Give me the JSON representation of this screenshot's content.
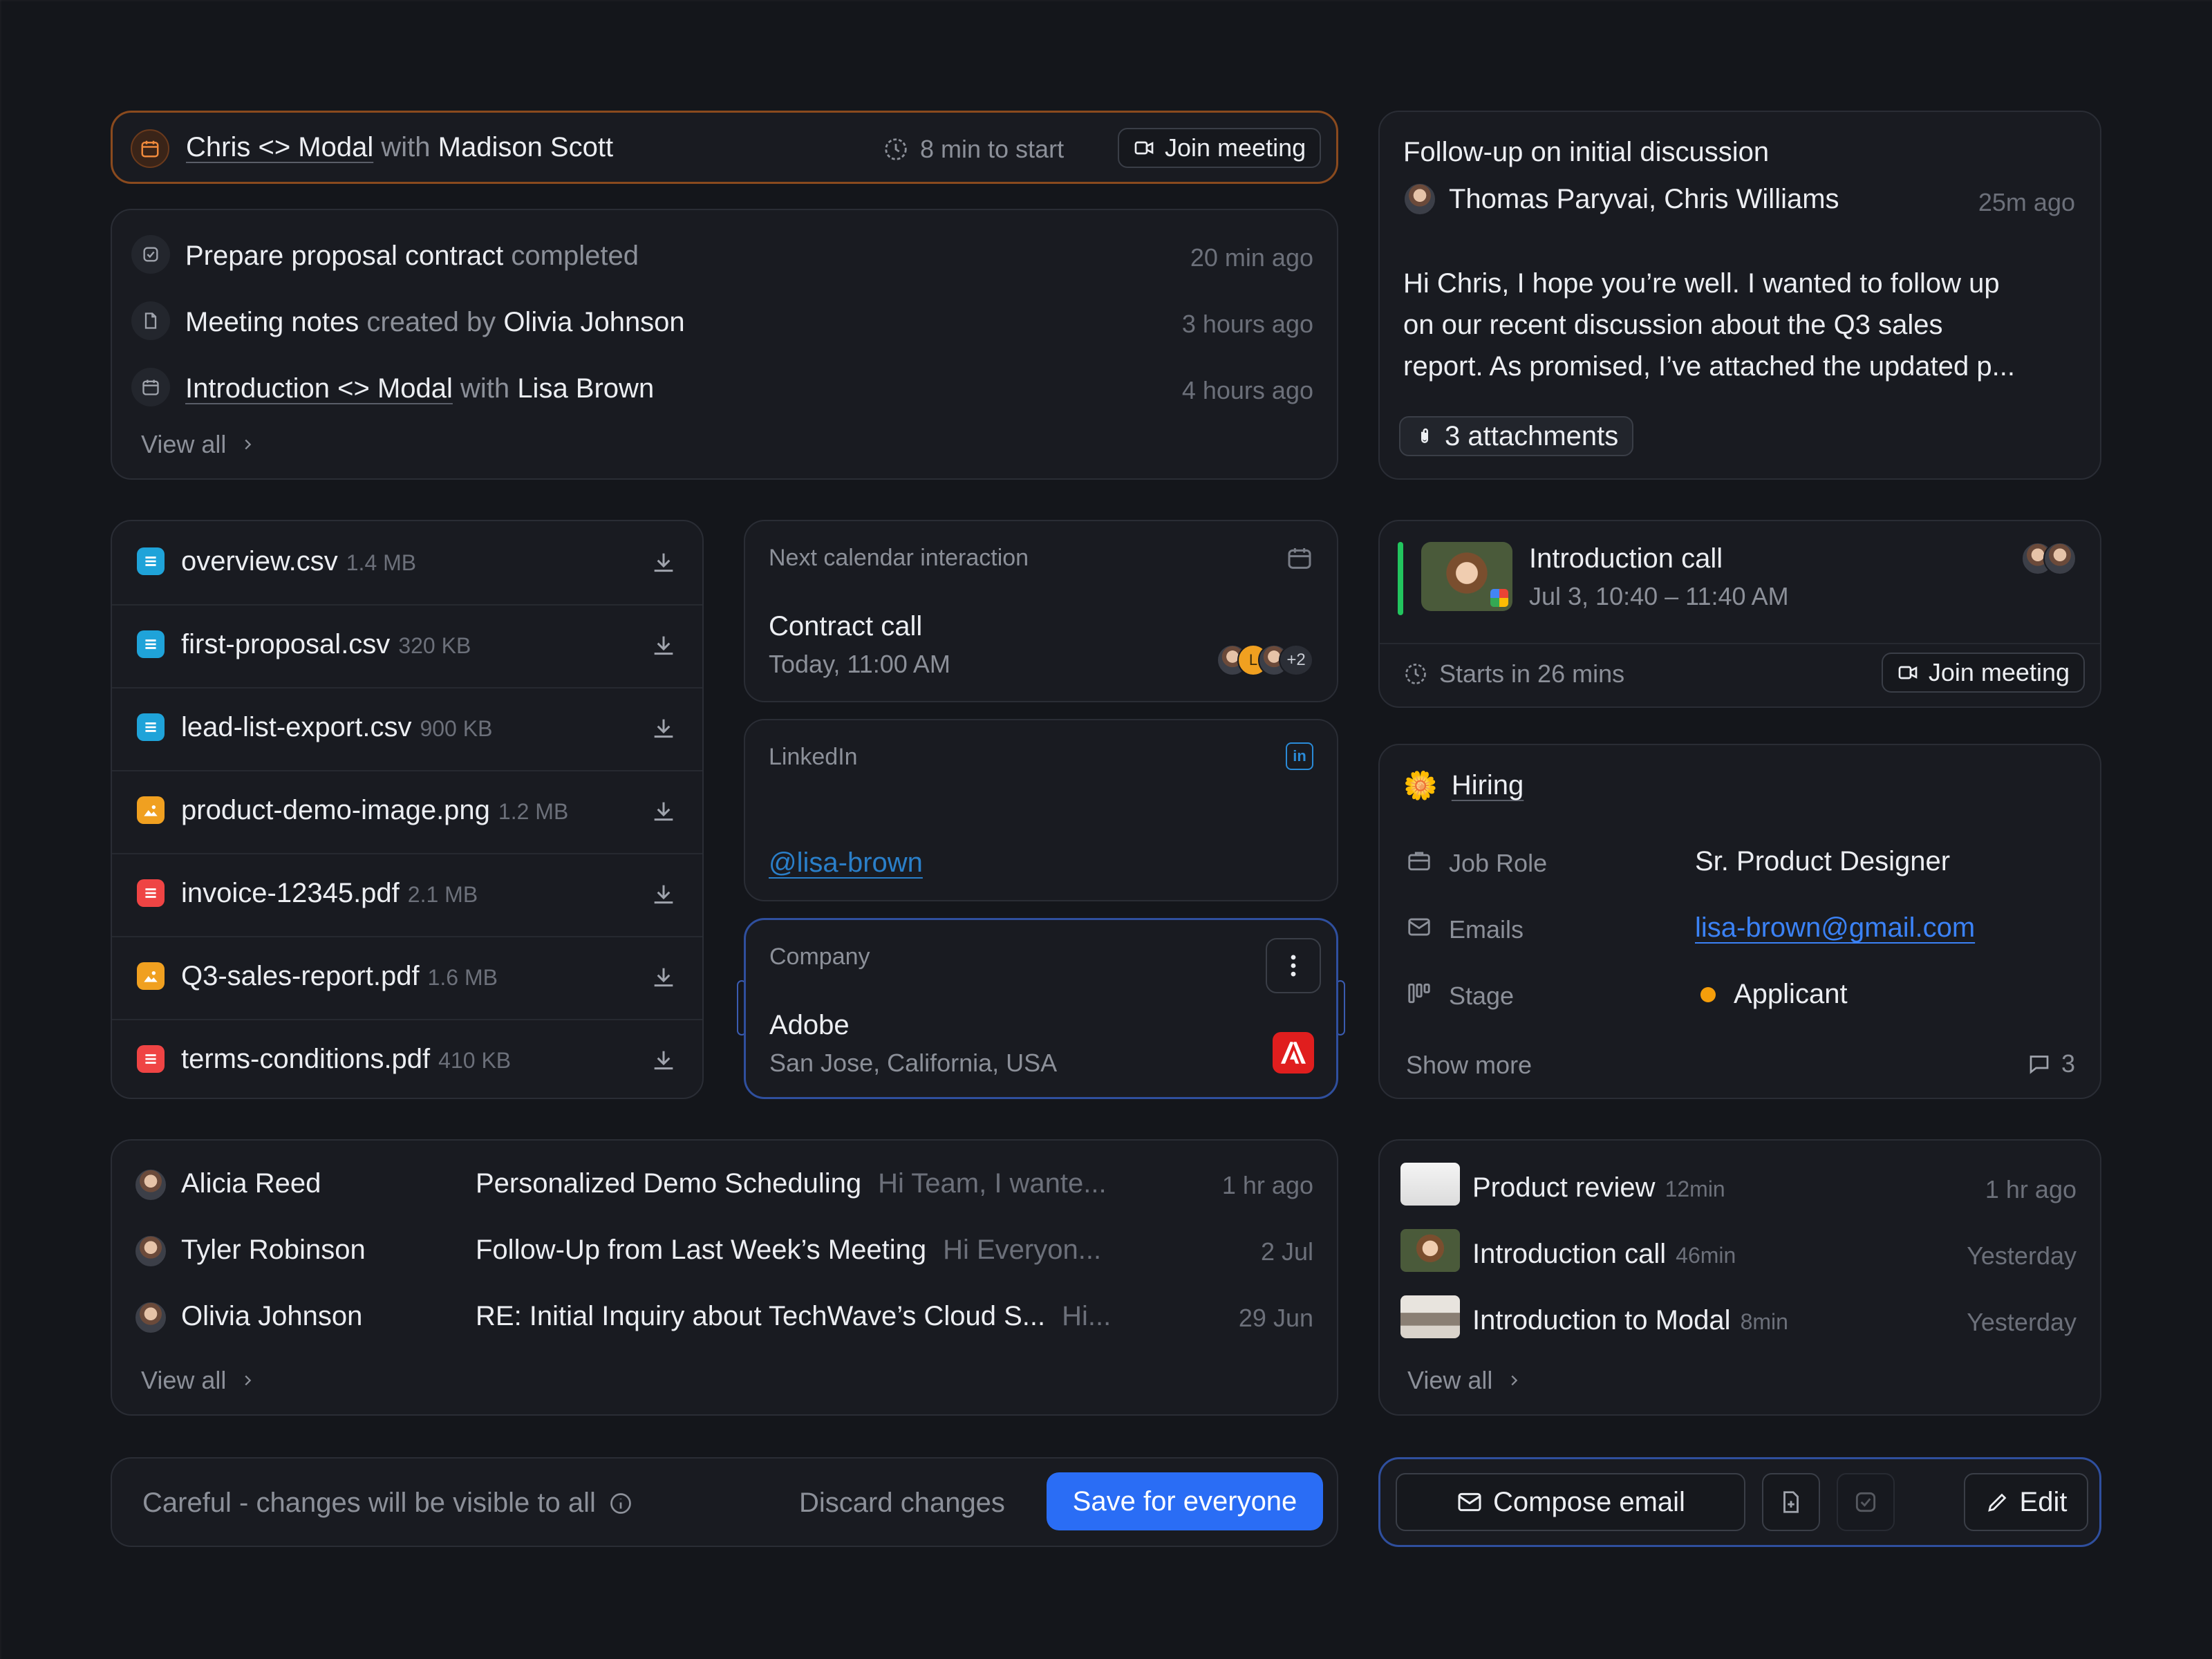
{
  "meeting_banner": {
    "title": "Chris <> Modal",
    "with_word": "with",
    "person": "Madison Scott",
    "countdown": "8 min to start",
    "join_label": "Join meeting"
  },
  "activity": {
    "items": [
      {
        "title": "Prepare proposal contract",
        "verb": "completed",
        "extra": "",
        "time": "20 min ago"
      },
      {
        "title": "Meeting notes",
        "verb": "created by",
        "extra": "Olivia Johnson",
        "time": "3 hours ago"
      },
      {
        "title": "Introduction <> Modal",
        "verb": "with",
        "extra": "Lisa Brown",
        "time": "4 hours ago"
      }
    ],
    "view_all": "View all"
  },
  "email_preview": {
    "subject": "Follow-up on initial discussion",
    "participants": "Thomas Paryvai, Chris Williams",
    "time": "25m ago",
    "body_line1": "Hi Chris, I hope you’re well. I wanted to follow up",
    "body_line2": "on our recent discussion about the Q3 sales",
    "body_line3": "report. As promised, I’ve attached the updated p...",
    "attachments": "3 attachments"
  },
  "files": [
    {
      "name": "overview.csv",
      "size": "1.4 MB",
      "kind": "csv",
      "color": "#1fa3d9"
    },
    {
      "name": "first-proposal.csv",
      "size": "320 KB",
      "kind": "csv",
      "color": "#1fa3d9"
    },
    {
      "name": "lead-list-export.csv",
      "size": "900 KB",
      "kind": "csv",
      "color": "#1fa3d9"
    },
    {
      "name": "product-demo-image.png",
      "size": "1.2 MB",
      "kind": "image",
      "color": "#f0a020"
    },
    {
      "name": "invoice-12345.pdf",
      "size": "2.1 MB",
      "kind": "pdf",
      "color": "#ef4444"
    },
    {
      "name": "Q3-sales-report.pdf",
      "size": "1.6 MB",
      "kind": "image",
      "color": "#f0a020"
    },
    {
      "name": "terms-conditions.pdf",
      "size": "410 KB",
      "kind": "pdf",
      "color": "#ef4444"
    }
  ],
  "next_calendar": {
    "label": "Next calendar interaction",
    "title": "Contract call",
    "time": "Today, 11:00 AM",
    "more": "+2",
    "initial": "L"
  },
  "linkedin": {
    "label": "LinkedIn",
    "handle": "@lisa-brown"
  },
  "company": {
    "label": "Company",
    "name": "Adobe",
    "location": "San Jose, California, USA"
  },
  "intro_call": {
    "title": "Introduction call",
    "time": "Jul 3, 10:40 – 11:40 AM",
    "starts": "Starts in 26 mins",
    "join_label": "Join meeting"
  },
  "hiring": {
    "title": "Hiring",
    "fields": [
      {
        "label": "Job Role",
        "value": "Sr. Product Designer"
      },
      {
        "label": "Emails",
        "value": "lisa-brown@gmail.com"
      },
      {
        "label": "Stage",
        "value": "Applicant"
      }
    ],
    "show_more": "Show more",
    "comment_count": "3"
  },
  "emails": {
    "rows": [
      {
        "name": "Alicia Reed",
        "subject": "Personalized Demo Scheduling",
        "preview": "Hi Team, I wante...",
        "time": "1 hr ago"
      },
      {
        "name": "Tyler Robinson",
        "subject": "Follow-Up from Last Week’s Meeting",
        "preview": "Hi Everyon...",
        "time": "2 Jul"
      },
      {
        "name": "Olivia Johnson",
        "subject": "RE: Initial Inquiry about TechWave’s Cloud S...",
        "preview": "Hi...",
        "time": "29 Jun"
      }
    ],
    "view_all": "View all"
  },
  "recordings": {
    "rows": [
      {
        "title": "Product review",
        "duration": "12min",
        "time": "1 hr ago"
      },
      {
        "title": "Introduction call",
        "duration": "46min",
        "time": "Yesterday"
      },
      {
        "title": "Introduction to Modal",
        "duration": "8min",
        "time": "Yesterday"
      }
    ],
    "view_all": "View all"
  },
  "save_bar": {
    "warning": "Careful - changes will be visible to all",
    "discard": "Discard changes",
    "save": "Save for everyone"
  },
  "action_bar": {
    "compose": "Compose email",
    "edit": "Edit"
  },
  "colors": {
    "accent_blue": "#2a6df5",
    "link_blue": "#3b82f6",
    "banner_orange": "#c2621e",
    "adobe_red": "#e01e1e",
    "stage_orange": "#f59e0b",
    "call_green": "#22c55e"
  }
}
